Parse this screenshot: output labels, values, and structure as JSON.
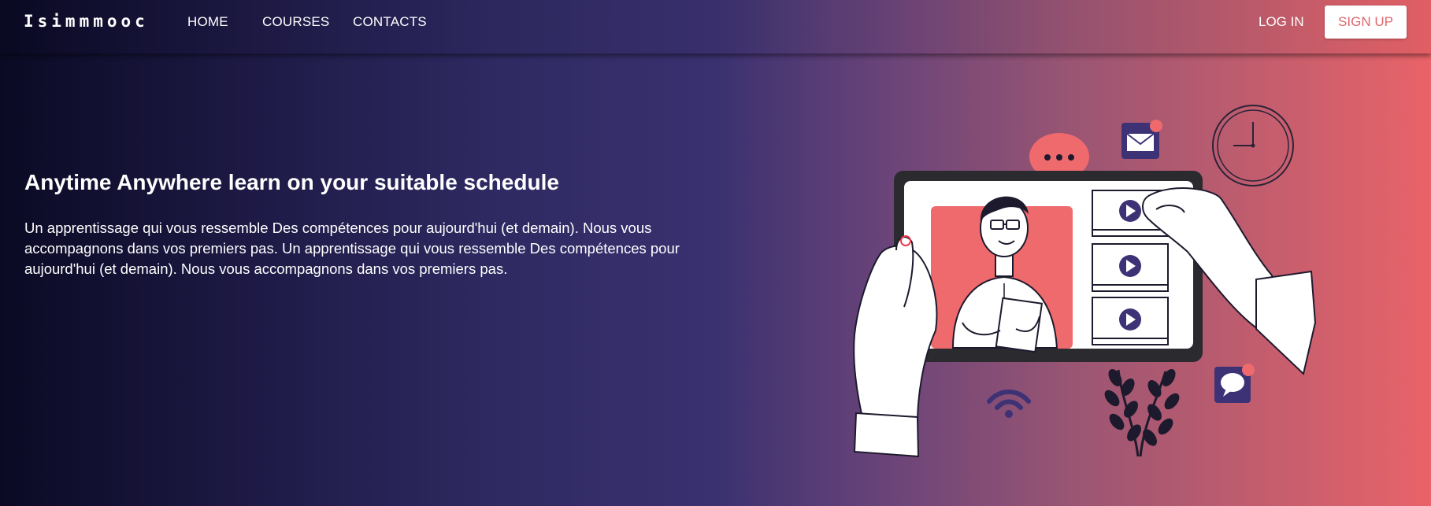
{
  "header": {
    "logo": "Isimmmooc",
    "nav": {
      "home": "HOME",
      "courses": "COURSES",
      "contacts": "CONTACTS"
    },
    "login": "LOG IN",
    "signup": "SIGN UP"
  },
  "hero": {
    "title": "Anytime Anywhere learn on your suitable schedule",
    "text": "Un apprentissage qui vous ressemble Des compétences pour aujourd'hui (et demain). Nous vous accompagnons dans vos premiers pas. Un apprentissage qui vous ressemble Des compétences pour aujourd'hui (et demain). Nous vous accompagnons dans vos premiers pas."
  },
  "colors": {
    "accent": "#e96368",
    "dark": "#0b0a24",
    "purple": "#3a3170"
  },
  "illustration": {
    "icons": [
      "tablet",
      "teacher",
      "video-play-icon",
      "mail-icon",
      "clock-icon",
      "chat-bubble-icon",
      "wifi-icon",
      "plant"
    ]
  }
}
